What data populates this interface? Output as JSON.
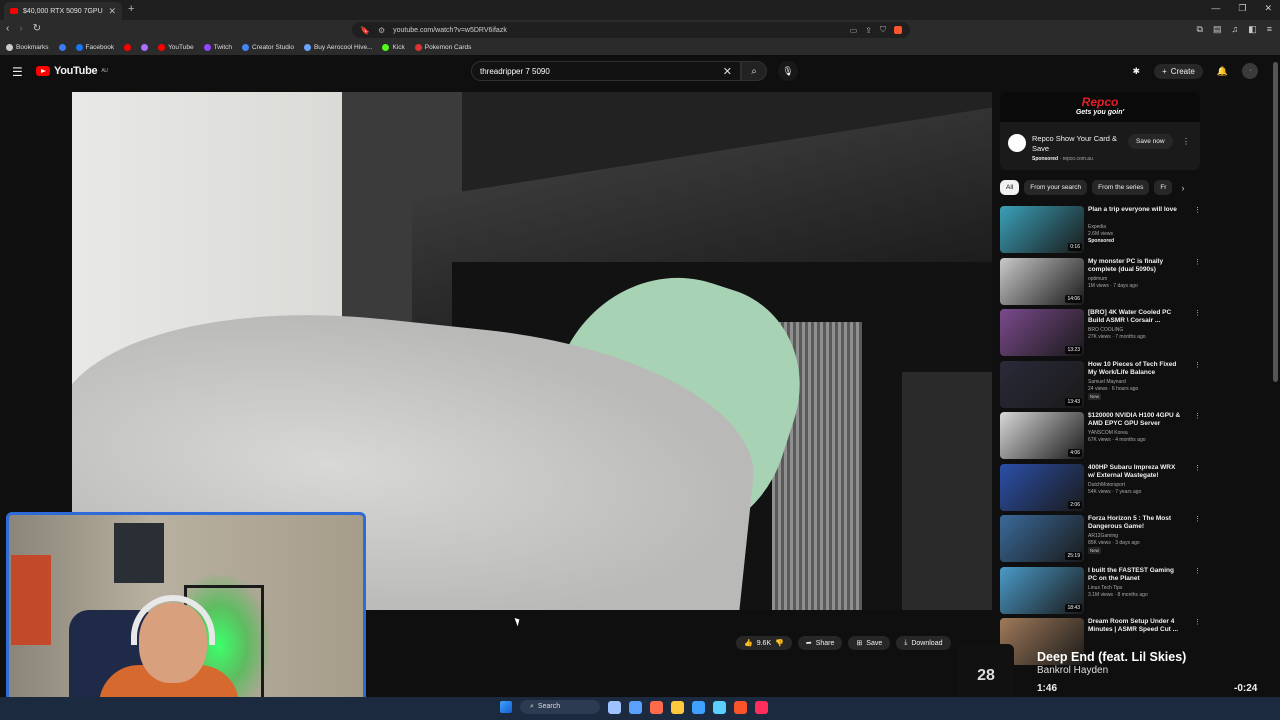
{
  "browser": {
    "tab_title": "$40,000 RTX 5090 7GPU Wo...",
    "url": "youtube.com/watch?v=w5DRV6ifazk",
    "bookmarks": [
      {
        "label": "Bookmarks",
        "color": "#cccccc"
      },
      {
        "label": "",
        "color": "#3d7bf5"
      },
      {
        "label": "Facebook",
        "color": "#1877f2"
      },
      {
        "label": "",
        "color": "#ff0000"
      },
      {
        "label": "",
        "color": "#a970ff"
      },
      {
        "label": "YouTube",
        "color": "#ff0000"
      },
      {
        "label": "Twitch",
        "color": "#9146ff"
      },
      {
        "label": "Creator Studio",
        "color": "#4285f4"
      },
      {
        "label": "Buy Aerocool Hive...",
        "color": "#6aa6ff"
      },
      {
        "label": "Kick",
        "color": "#53fc18"
      },
      {
        "label": "Pokemon Cards",
        "color": "#dd3333"
      }
    ]
  },
  "youtube": {
    "logo_text": "YouTube",
    "region": "AU",
    "search_query": "threadripper 7 5090",
    "create_label": "Create"
  },
  "video_actions": {
    "likes": "9.6K",
    "share": "Share",
    "save": "Save",
    "download": "Download"
  },
  "ad": {
    "brand": "Repco",
    "tagline": "Gets you goin'",
    "title": "Repco Show Your Card & Save",
    "sponsored": "Sponsored",
    "domain": "repco.com.au",
    "cta": "Save now"
  },
  "chips": [
    "All",
    "From your search",
    "From the series",
    "Fr"
  ],
  "recommendations": [
    {
      "title": "Plan a trip everyone will love",
      "channel": "Expedia",
      "views": "2.6M views",
      "extra": "Sponsored",
      "duration": "0:16",
      "thumb": "#3aa0b8"
    },
    {
      "title": "My monster PC is finally complete (dual 5090s)",
      "channel": "optimum",
      "views": "1M views · 7 days ago",
      "extra": "",
      "duration": "14:06",
      "thumb": "#c9c9c9"
    },
    {
      "title": "[BRO] 4K Water Cooled PC Build ASMR \\ Corsair ...",
      "channel": "BRO COOLING",
      "views": "27K views · 7 months ago",
      "extra": "",
      "duration": "13:23",
      "thumb": "#7a4a8c"
    },
    {
      "title": "How 10 Pieces of Tech Fixed My Work/Life Balance",
      "channel": "Samuel Maynard",
      "views": "24 views · 6 hours ago",
      "extra": "New",
      "duration": "13:43",
      "thumb": "#2a2a3a"
    },
    {
      "title": "$120000 NVIDIA H100 4GPU & AMD EPYC GPU Server",
      "channel": "YANSCOM Korea",
      "views": "67K views · 4 months ago",
      "extra": "",
      "duration": "4:06",
      "thumb": "#d8d8d8"
    },
    {
      "title": "400HP Subaru Impreza WRX w/ External Wastegate!",
      "channel": "DutchMotorsport",
      "views": "54K views · 7 years ago",
      "extra": "",
      "duration": "2:06",
      "thumb": "#2b4fa8"
    },
    {
      "title": "Forza Horizon 5 : The Most Dangerous Game!",
      "channel": "AR12Gaming",
      "views": "85K views · 3 days ago",
      "extra": "New",
      "duration": "25:19",
      "thumb": "#3a6a9a"
    },
    {
      "title": "I built the FASTEST Gaming PC on the Planet",
      "channel": "Linus Tech Tips",
      "views": "3.1M views · 8 months ago",
      "extra": "",
      "duration": "18:43",
      "thumb": "#4a9ac8"
    },
    {
      "title": "Dream Room Setup Under 4 Minutes | ASMR Speed Cut ...",
      "channel": "",
      "views": "",
      "extra": "",
      "duration": "",
      "thumb": "#a07a5a"
    }
  ],
  "now_playing": {
    "title": "Deep End (feat. Lil Skies)",
    "artist": "Bankrol Hayden",
    "current": "1:46",
    "remaining": "-0:24",
    "progress": 0.81,
    "art_text": "28"
  },
  "taskbar": {
    "search": "Search",
    "apps": [
      "#9ec3ff",
      "#5ca0ff",
      "#ff6a4d",
      "#ffc83d",
      "#3ea0ff",
      "#5bd0ff",
      "#fb542b",
      "#ff2e5a"
    ]
  }
}
